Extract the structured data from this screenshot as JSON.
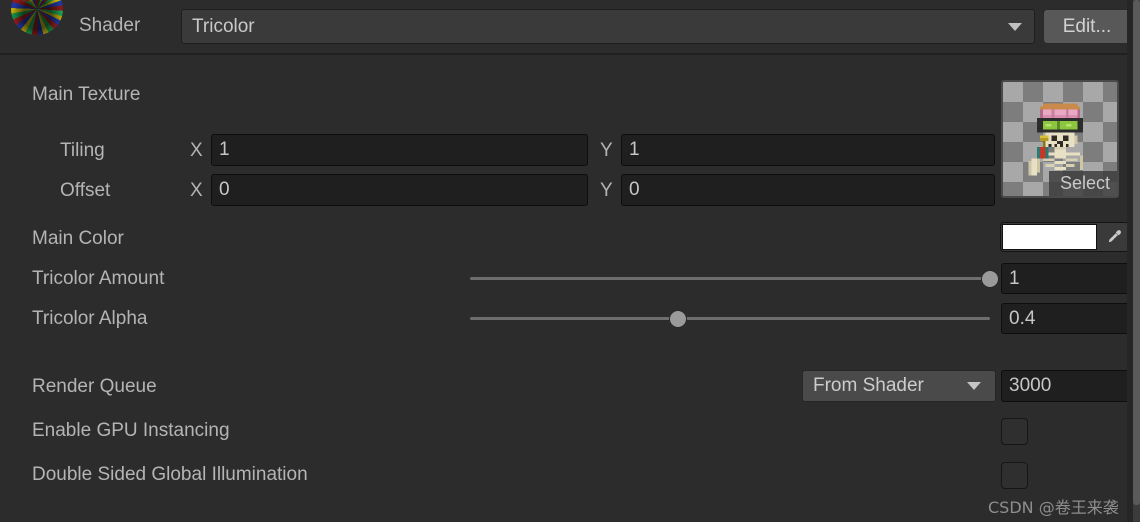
{
  "header": {
    "material_preview_icon": "material-sphere-preview-icon",
    "shader_label": "Shader",
    "shader_value": "Tricolor",
    "shader_dropdown_icon": "chevron-down-icon",
    "edit_button_label": "Edit..."
  },
  "properties": {
    "main_texture": {
      "label": "Main Texture",
      "thumbnail_alt": "skeleton-sprite-texture",
      "select_button_label": "Select",
      "tiling": {
        "label": "Tiling",
        "x_axis": "X",
        "x_value": "1",
        "y_axis": "Y",
        "y_value": "1"
      },
      "offset": {
        "label": "Offset",
        "x_axis": "X",
        "x_value": "0",
        "y_axis": "Y",
        "y_value": "0"
      }
    },
    "main_color": {
      "label": "Main Color",
      "swatch_hex": "#ffffff",
      "eyedropper_icon": "eyedropper-icon"
    },
    "tricolor_amount": {
      "label": "Tricolor Amount",
      "value": "1",
      "slider_percent": 100
    },
    "tricolor_alpha": {
      "label": "Tricolor Alpha",
      "value": "0.4",
      "slider_percent": 40
    }
  },
  "render_settings": {
    "render_queue": {
      "label": "Render Queue",
      "mode": "From Shader",
      "mode_dropdown_icon": "chevron-down-icon",
      "value": "3000"
    },
    "gpu_instancing": {
      "label": "Enable GPU Instancing",
      "checked": false
    },
    "double_sided_gi": {
      "label": "Double Sided Global Illumination",
      "checked": false
    }
  },
  "watermark": "CSDN @卷王来袭",
  "colors": {
    "background": "#2c2c2c",
    "field_background": "#1f1f1f",
    "dropdown_background": "#3a3a3a",
    "button_background": "#585858",
    "text": "#b4b4b4",
    "slider_track": "#6e6e6e",
    "slider_handle": "#9a9a9a"
  }
}
